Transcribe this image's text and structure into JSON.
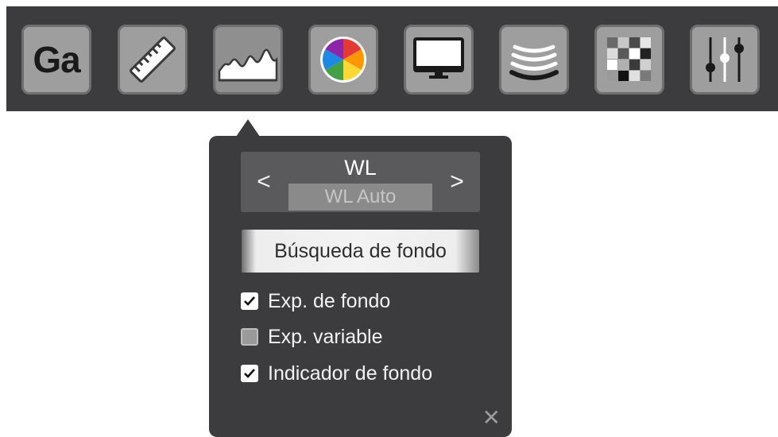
{
  "toolbar": {
    "items": [
      {
        "name": "gain",
        "icon": "gain-text-icon",
        "label": "Ga"
      },
      {
        "name": "measure",
        "icon": "ruler-icon"
      },
      {
        "name": "histogram",
        "icon": "histogram-icon",
        "active": true
      },
      {
        "name": "color",
        "icon": "color-wheel-icon"
      },
      {
        "name": "display",
        "icon": "monitor-icon"
      },
      {
        "name": "sonar",
        "icon": "waves-icon"
      },
      {
        "name": "grid",
        "icon": "grid-icon"
      },
      {
        "name": "adjust",
        "icon": "sliders-icon"
      }
    ]
  },
  "popup": {
    "mode_label": "WL",
    "mode_value": "WL Auto",
    "prev_label": "<",
    "next_label": ">",
    "search_button": "Búsqueda de fondo",
    "options": [
      {
        "label": "Exp. de fondo",
        "checked": true
      },
      {
        "label": "Exp. variable",
        "checked": false
      },
      {
        "label": "Indicador de fondo",
        "checked": true
      }
    ],
    "close_label": "✕"
  },
  "colors": {
    "toolbar_bg": "#3c3c3e",
    "tool_bg": "#9e9e9e",
    "popup_bg": "#3c3c3e",
    "wl_bg": "#5a5a5c"
  }
}
